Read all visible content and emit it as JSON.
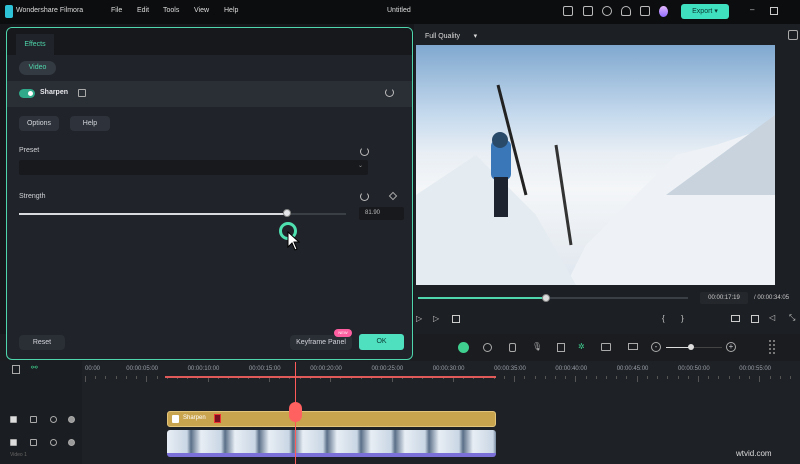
{
  "app": {
    "name": "Wondershare Filmora",
    "title": "Untitled",
    "menu": [
      "File",
      "Edit",
      "Tools",
      "View",
      "Help"
    ],
    "export_label": "Export",
    "accent": "#3fe0c0"
  },
  "effects_panel": {
    "tab": "Effects",
    "subtab": "Video",
    "effect_name": "Sharpen",
    "effect_enabled": true,
    "options_label": "Options",
    "help_label": "Help",
    "preset_label": "Preset",
    "preset_value": "",
    "strength_label": "Strength",
    "strength_value": "81.90",
    "strength_fraction": 0.82,
    "reset_label": "Reset",
    "keyframe_label": "Keyframe Panel",
    "keyframe_badge": "NEW",
    "ok_label": "OK"
  },
  "player": {
    "quality": "Full Quality",
    "current_time": "00:00:17:19",
    "total_time": "/ 00:00:34:05",
    "progress_fraction": 0.5
  },
  "timeline": {
    "ruler": [
      "00:00",
      "00:00:05:00",
      "00:00:10:00",
      "00:00:15:00",
      "00:00:20:00",
      "00:00:25:00",
      "00:00:30:00",
      "00:00:35:00",
      "00:00:40:00",
      "00:00:45:00",
      "00:00:50:00",
      "00:00:55:00"
    ],
    "effect_clip": "Sharpen",
    "video_track_label": "Video 1"
  },
  "watermark": "wtvid.com"
}
